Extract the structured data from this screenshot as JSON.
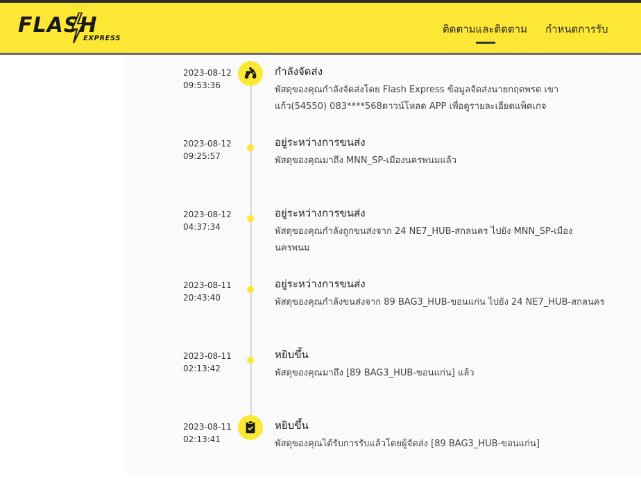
{
  "header": {
    "logo": {
      "main": "FLASH",
      "sub": "EXPRESS"
    },
    "nav": [
      {
        "label": "ติดตามและติดตาม"
      },
      {
        "label": "กำหนดการรับ"
      }
    ]
  },
  "colors": {
    "brand_yellow": "#fce834",
    "dark": "#2c2c2c"
  },
  "events": [
    {
      "date": "2023-08-12",
      "time": "09:53:36",
      "title": "กำลังจัดส่ง",
      "description": "พัสดุของคุณกำลังจัดส่งโดย Flash Express ข้อมูลจัดส่งนายกฤตพรต เขาแก้ว(54550) 083****568ดาวน์โหลด APP เพื่อดูรายละเอียดแพ็คเกจ",
      "icon": "delivery-scooter-icon"
    },
    {
      "date": "2023-08-12",
      "time": "09:25:57",
      "title": "อยู่ระหว่างการขนส่ง",
      "description": "พัสดุของคุณมาถึง MNN_SP-เมืองนครพนมแล้ว"
    },
    {
      "date": "2023-08-12",
      "time": "04:37:34",
      "title": "อยู่ระหว่างการขนส่ง",
      "description": "พัสดุของคุณกำลังถูกขนส่งจาก 24 NE7_HUB-สกลนคร ไปยัง MNN_SP-เมืองนครพนม"
    },
    {
      "date": "2023-08-11",
      "time": "20:43:40",
      "title": "อยู่ระหว่างการขนส่ง",
      "description": "พัสดุของคุณกำลังขนส่งจาก 89 BAG3_HUB-ขอนแก่น ไปยัง 24 NE7_HUB-สกลนคร"
    },
    {
      "date": "2023-08-11",
      "time": "02:13:42",
      "title": "หยิบขึ้น",
      "description": "พัสดุของคุณมาถึง [89 BAG3_HUB-ขอนแก่น] แล้ว"
    },
    {
      "date": "2023-08-11",
      "time": "02:13:41",
      "title": "หยิบขึ้น",
      "description": "พัสดุของคุณได้รับการรับแล้วโดยผู้จัดส่ง [89 BAG3_HUB-ขอนแก่น]",
      "icon": "clipboard-check-icon"
    }
  ]
}
